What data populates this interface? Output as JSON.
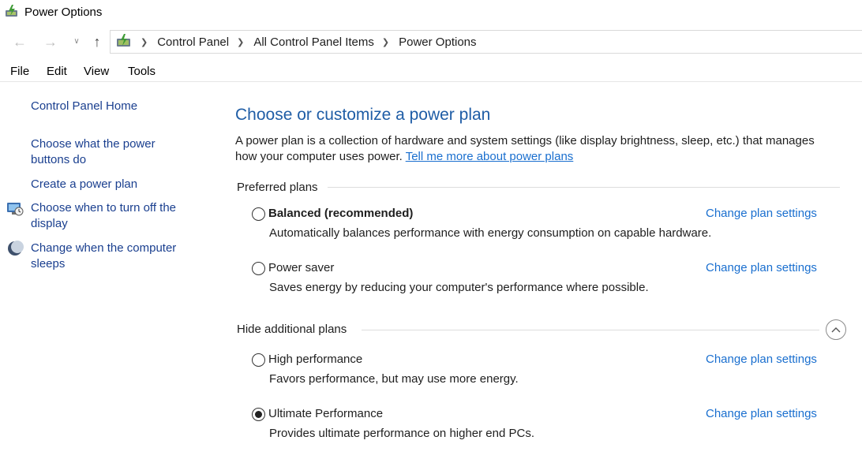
{
  "window": {
    "title": "Power Options",
    "icon": "power-options-icon"
  },
  "address_bar": {
    "location_icon": "control-panel-icon",
    "crumbs": [
      "Control Panel",
      "All Control Panel Items",
      "Power Options"
    ]
  },
  "menu": [
    "File",
    "Edit",
    "View",
    "Tools"
  ],
  "sidebar": {
    "home": "Control Panel Home",
    "links": [
      {
        "label_line1": "Choose what the power",
        "label_line2": "buttons do",
        "icon": ""
      },
      {
        "label_line1": "Create a power plan",
        "label_line2": "",
        "icon": ""
      },
      {
        "label_line1": "Choose when to turn off the",
        "label_line2": "display",
        "icon": "monitor-clock-icon"
      },
      {
        "label_line1": "Change when the computer",
        "label_line2": "sleeps",
        "icon": "moon-sleep-icon"
      }
    ]
  },
  "main": {
    "title": "Choose or customize a power plan",
    "description_line1": "A power plan is a collection of hardware and system settings (like display brightness, sleep, etc.) that manages",
    "description_line2_prefix": "how your computer uses power.",
    "description_link": "Tell me more about power plans",
    "preferred_header": "Preferred plans",
    "additional_header": "Hide additional plans",
    "change_link": "Change plan settings",
    "plans": [
      {
        "name": "Balanced (recommended)",
        "description": "Automatically balances performance with energy consumption on capable hardware.",
        "selected": false,
        "bold": true
      },
      {
        "name": "Power saver",
        "description": "Saves energy by reducing your computer's performance where possible.",
        "selected": false,
        "bold": false
      },
      {
        "name": "High performance",
        "description": "Favors performance, but may use more energy.",
        "selected": false,
        "bold": false
      },
      {
        "name": "Ultimate Performance",
        "description": "Provides ultimate performance on higher end PCs.",
        "selected": true,
        "bold": false
      }
    ]
  },
  "colors": {
    "link": "#1a6fcf",
    "title": "#1f5da6",
    "nav_link": "#1a3f8f"
  }
}
